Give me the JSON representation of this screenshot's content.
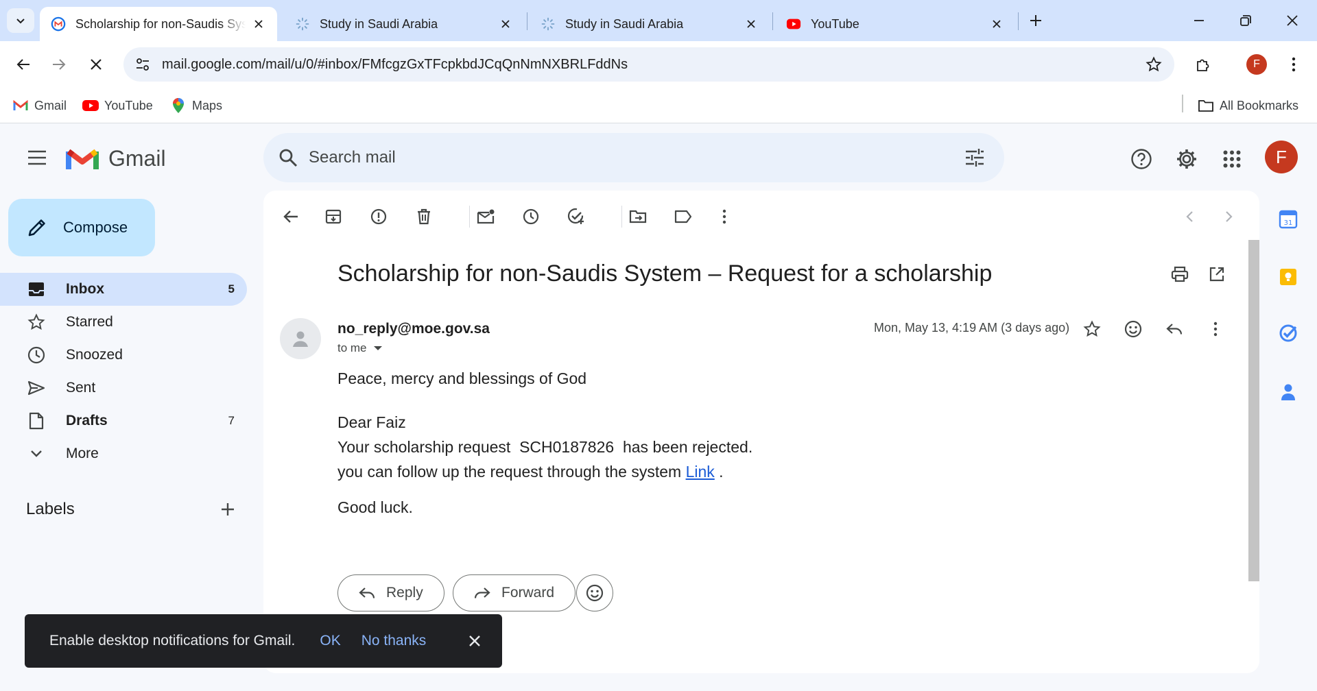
{
  "browser": {
    "tabs": [
      {
        "title": "Scholarship for non-Saudis System – Request for a scholarship",
        "active": true
      },
      {
        "title": "Study in Saudi Arabia",
        "active": false
      },
      {
        "title": "Study in Saudi Arabia",
        "active": false
      },
      {
        "title": "YouTube",
        "active": false
      }
    ],
    "url": "mail.google.com/mail/u/0/#inbox/FMfcgzGxTFcpkbdJCqQnNmNXBRLFddNs",
    "profile_initial": "F",
    "bookmarks": [
      "Gmail",
      "YouTube",
      "Maps"
    ],
    "all_bookmarks": "All Bookmarks"
  },
  "gmail": {
    "brand": "Gmail",
    "search_placeholder": "Search mail",
    "avatar_initial": "F",
    "compose_label": "Compose",
    "nav": [
      {
        "label": "Inbox",
        "count": "5"
      },
      {
        "label": "Starred",
        "count": ""
      },
      {
        "label": "Snoozed",
        "count": ""
      },
      {
        "label": "Sent",
        "count": ""
      },
      {
        "label": "Drafts",
        "count": "7"
      },
      {
        "label": "More",
        "count": ""
      }
    ],
    "labels_heading": "Labels"
  },
  "message": {
    "subject": "Scholarship for non-Saudis System – Request for a scholarship",
    "sender": "no_reply@moe.gov.sa",
    "recipient": "to me",
    "date": "Mon, May 13, 4:19 AM (3 days ago)",
    "greeting": "Peace, mercy and blessings of God",
    "salutation": "Dear Faiz",
    "line1": "Your scholarship request  SCH0187826  has been rejected.",
    "line2_prefix": "you can follow up the request through the system ",
    "link_text": "Link",
    "line2_suffix": " .",
    "closing": "Good luck.",
    "reply_label": "Reply",
    "forward_label": "Forward"
  },
  "snackbar": {
    "text": "Enable desktop notifications for Gmail.",
    "ok": "OK",
    "no_thanks": "No thanks"
  },
  "colors": {
    "accent": "#0b57d0",
    "compose_bg": "#c2e7ff",
    "active_nav_bg": "#d3e3fd",
    "avatar_bg": "#c5391f",
    "link": "#1a5bd6"
  }
}
